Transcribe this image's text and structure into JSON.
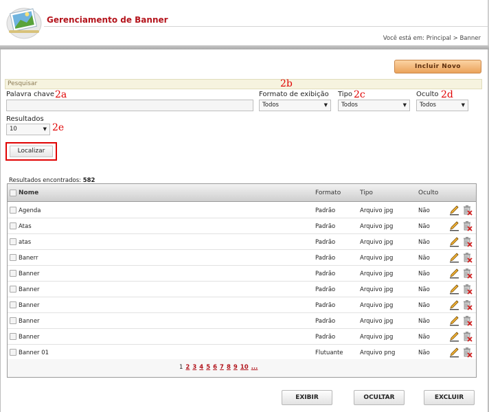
{
  "header": {
    "title": "Gerenciamento de Banner",
    "breadcrumb_prefix": "Você está em:",
    "breadcrumb": [
      "Principal",
      "Banner"
    ],
    "breadcrumb_sep": ">"
  },
  "toolbar": {
    "new_label": "Incluir Novo"
  },
  "search": {
    "title": "Pesquisar",
    "keyword_label": "Palavra chave",
    "keyword_value": "",
    "format_label": "Formato de exibição",
    "format_value": "Todos",
    "type_label": "Tipo",
    "type_value": "Todos",
    "hidden_label": "Oculto",
    "hidden_value": "Todos",
    "results_label": "Resultados",
    "results_value": "10",
    "find_label": "Localizar"
  },
  "annotations": {
    "a": "2a",
    "b": "2b",
    "c": "2c",
    "d": "2d",
    "e": "2e"
  },
  "results": {
    "count_label": "Resultados encontrados:",
    "count": "582",
    "columns": {
      "name": "Nome",
      "format": "Formato",
      "type": "Tipo",
      "hidden": "Oculto"
    },
    "rows": [
      {
        "name": "Agenda",
        "format": "Padrão",
        "type": "Arquivo jpg",
        "hidden": "Não"
      },
      {
        "name": "Atas",
        "format": "Padrão",
        "type": "Arquivo jpg",
        "hidden": "Não"
      },
      {
        "name": "atas",
        "format": "Padrão",
        "type": "Arquivo jpg",
        "hidden": "Não"
      },
      {
        "name": "Banerr",
        "format": "Padrão",
        "type": "Arquivo jpg",
        "hidden": "Não"
      },
      {
        "name": "Banner",
        "format": "Padrão",
        "type": "Arquivo jpg",
        "hidden": "Não"
      },
      {
        "name": "Banner",
        "format": "Padrão",
        "type": "Arquivo jpg",
        "hidden": "Não"
      },
      {
        "name": "Banner",
        "format": "Padrão",
        "type": "Arquivo jpg",
        "hidden": "Não"
      },
      {
        "name": "Banner",
        "format": "Padrão",
        "type": "Arquivo jpg",
        "hidden": "Não"
      },
      {
        "name": "Banner",
        "format": "Padrão",
        "type": "Arquivo jpg",
        "hidden": "Não"
      },
      {
        "name": "Banner 01",
        "format": "Flutuante",
        "type": "Arquivo png",
        "hidden": "Não"
      }
    ],
    "pages": [
      "1",
      "2",
      "3",
      "4",
      "5",
      "6",
      "7",
      "8",
      "9",
      "10",
      "..."
    ],
    "current_page": "1"
  },
  "actions": {
    "show": "EXIBIR",
    "hide": "OCULTAR",
    "delete": "EXCLUIR"
  },
  "colors": {
    "title_red": "#b4141c",
    "annotation_red": "#e00000",
    "accent_orange": "#eba35b"
  }
}
